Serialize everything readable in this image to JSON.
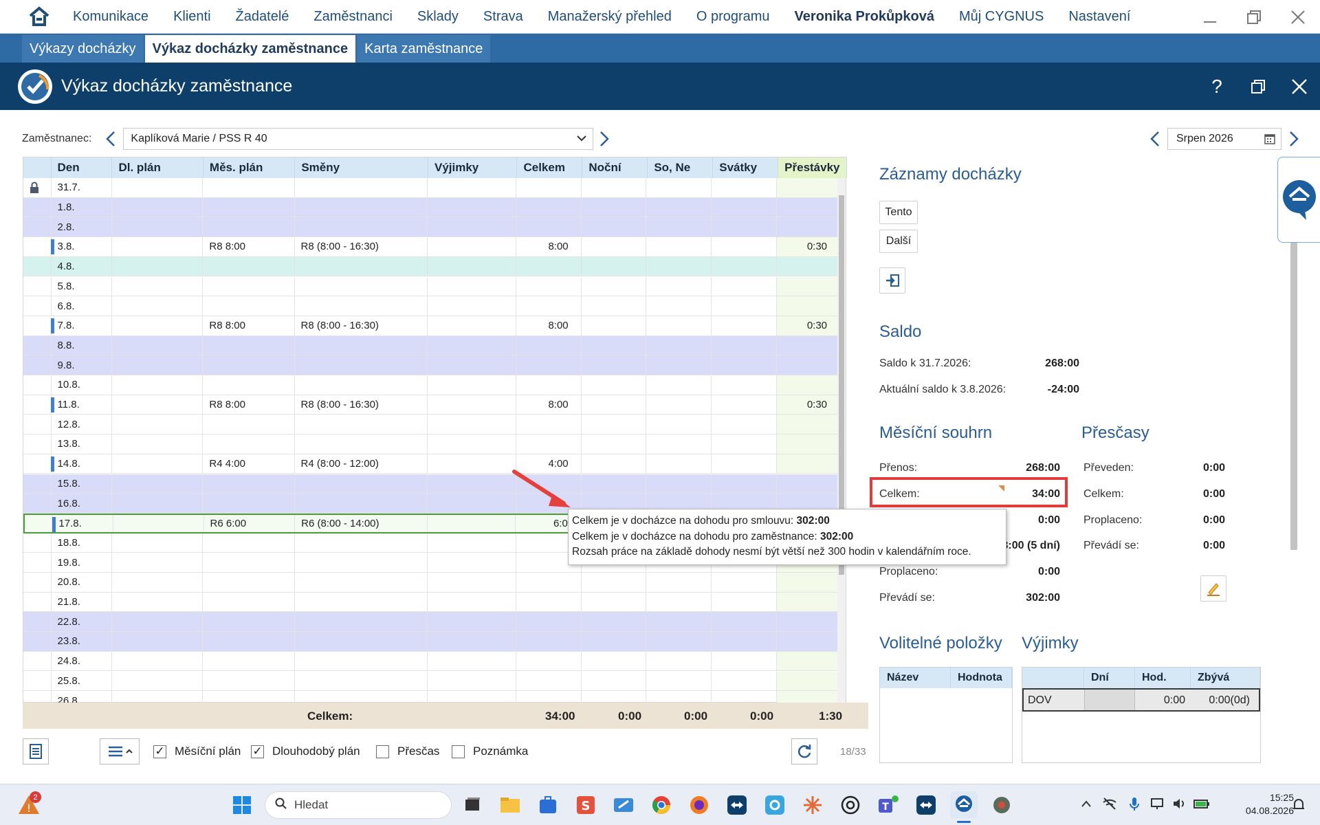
{
  "menu": {
    "items": [
      "Komunikace",
      "Klienti",
      "Žadatelé",
      "Zaměstnanci",
      "Sklady",
      "Strava",
      "Manažerský přehled",
      "O programu"
    ],
    "user": "Veronika Prokůpková",
    "extra": [
      "Můj CYGNUS",
      "Nastavení"
    ]
  },
  "tabs": [
    "Výkazy docházky",
    "Výkaz docházky zaměstnance",
    "Karta zaměstnance"
  ],
  "window": {
    "title": "Výkaz docházky zaměstnance",
    "help": "?"
  },
  "employee": {
    "label": "Zaměstnanec:",
    "value": "Kaplíková Marie / PSS R 40"
  },
  "month": {
    "value": "Srpen 2026"
  },
  "grid": {
    "columns": [
      "Den",
      "Dl. plán",
      "Měs. plán",
      "Směny",
      "Výjimky",
      "Celkem",
      "Noční",
      "So, Ne",
      "Svátky",
      "Přestávky"
    ],
    "rows": [
      {
        "den": "31.7.",
        "dl": "",
        "mes": "",
        "smeny": "",
        "vyjimky": "",
        "celkem": "",
        "nocni": "",
        "sone": "",
        "svatky": "",
        "prestavky": "",
        "type": "locked"
      },
      {
        "den": "1.8.",
        "dl": "",
        "mes": "",
        "smeny": "",
        "vyjimky": "",
        "celkem": "",
        "nocni": "",
        "sone": "",
        "svatky": "",
        "prestavky": "",
        "type": "we"
      },
      {
        "den": "2.8.",
        "dl": "",
        "mes": "",
        "smeny": "",
        "vyjimky": "",
        "celkem": "",
        "nocni": "",
        "sone": "",
        "svatky": "",
        "prestavky": "",
        "type": "we"
      },
      {
        "den": "3.8.",
        "dl": "",
        "mes": "R8 8:00",
        "smeny": "R8 (8:00 - 16:30)",
        "vyjimky": "",
        "celkem": "8:00",
        "nocni": "",
        "sone": "",
        "svatky": "",
        "prestavky": "0:30",
        "type": "work"
      },
      {
        "den": "4.8.",
        "dl": "",
        "mes": "",
        "smeny": "",
        "vyjimky": "",
        "celkem": "",
        "nocni": "",
        "sone": "",
        "svatky": "",
        "prestavky": "",
        "type": "hol"
      },
      {
        "den": "5.8.",
        "dl": "",
        "mes": "",
        "smeny": "",
        "vyjimky": "",
        "celkem": "",
        "nocni": "",
        "sone": "",
        "svatky": "",
        "prestavky": "",
        "type": ""
      },
      {
        "den": "6.8.",
        "dl": "",
        "mes": "",
        "smeny": "",
        "vyjimky": "",
        "celkem": "",
        "nocni": "",
        "sone": "",
        "svatky": "",
        "prestavky": "",
        "type": ""
      },
      {
        "den": "7.8.",
        "dl": "",
        "mes": "R8 8:00",
        "smeny": "R8 (8:00 - 16:30)",
        "vyjimky": "",
        "celkem": "8:00",
        "nocni": "",
        "sone": "",
        "svatky": "",
        "prestavky": "0:30",
        "type": "work"
      },
      {
        "den": "8.8.",
        "dl": "",
        "mes": "",
        "smeny": "",
        "vyjimky": "",
        "celkem": "",
        "nocni": "",
        "sone": "",
        "svatky": "",
        "prestavky": "",
        "type": "we"
      },
      {
        "den": "9.8.",
        "dl": "",
        "mes": "",
        "smeny": "",
        "vyjimky": "",
        "celkem": "",
        "nocni": "",
        "sone": "",
        "svatky": "",
        "prestavky": "",
        "type": "we"
      },
      {
        "den": "10.8.",
        "dl": "",
        "mes": "",
        "smeny": "",
        "vyjimky": "",
        "celkem": "",
        "nocni": "",
        "sone": "",
        "svatky": "",
        "prestavky": "",
        "type": ""
      },
      {
        "den": "11.8.",
        "dl": "",
        "mes": "R8 8:00",
        "smeny": "R8 (8:00 - 16:30)",
        "vyjimky": "",
        "celkem": "8:00",
        "nocni": "",
        "sone": "",
        "svatky": "",
        "prestavky": "0:30",
        "type": "work"
      },
      {
        "den": "12.8.",
        "dl": "",
        "mes": "",
        "smeny": "",
        "vyjimky": "",
        "celkem": "",
        "nocni": "",
        "sone": "",
        "svatky": "",
        "prestavky": "",
        "type": ""
      },
      {
        "den": "13.8.",
        "dl": "",
        "mes": "",
        "smeny": "",
        "vyjimky": "",
        "celkem": "",
        "nocni": "",
        "sone": "",
        "svatky": "",
        "prestavky": "",
        "type": ""
      },
      {
        "den": "14.8.",
        "dl": "",
        "mes": "R4 4:00",
        "smeny": "R4 (8:00 - 12:00)",
        "vyjimky": "",
        "celkem": "4:00",
        "nocni": "",
        "sone": "",
        "svatky": "",
        "prestavky": "",
        "type": "work"
      },
      {
        "den": "15.8.",
        "dl": "",
        "mes": "",
        "smeny": "",
        "vyjimky": "",
        "celkem": "",
        "nocni": "",
        "sone": "",
        "svatky": "",
        "prestavky": "",
        "type": "we"
      },
      {
        "den": "16.8.",
        "dl": "",
        "mes": "",
        "smeny": "",
        "vyjimky": "",
        "celkem": "",
        "nocni": "",
        "sone": "",
        "svatky": "",
        "prestavky": "",
        "type": "we"
      },
      {
        "den": "17.8.",
        "dl": "",
        "mes": "R6 6:00",
        "smeny": "R6 (8:00 - 14:00)",
        "vyjimky": "",
        "celkem": "6:0",
        "nocni": "",
        "sone": "",
        "svatky": "",
        "prestavky": "",
        "type": "sel"
      },
      {
        "den": "18.8.",
        "dl": "",
        "mes": "",
        "smeny": "",
        "vyjimky": "",
        "celkem": "",
        "nocni": "",
        "sone": "",
        "svatky": "",
        "prestavky": "",
        "type": ""
      },
      {
        "den": "19.8.",
        "dl": "",
        "mes": "",
        "smeny": "",
        "vyjimky": "",
        "celkem": "",
        "nocni": "",
        "sone": "",
        "svatky": "",
        "prestavky": "",
        "type": ""
      },
      {
        "den": "20.8.",
        "dl": "",
        "mes": "",
        "smeny": "",
        "vyjimky": "",
        "celkem": "",
        "nocni": "",
        "sone": "",
        "svatky": "",
        "prestavky": "",
        "type": ""
      },
      {
        "den": "21.8.",
        "dl": "",
        "mes": "",
        "smeny": "",
        "vyjimky": "",
        "celkem": "",
        "nocni": "",
        "sone": "",
        "svatky": "",
        "prestavky": "",
        "type": ""
      },
      {
        "den": "22.8.",
        "dl": "",
        "mes": "",
        "smeny": "",
        "vyjimky": "",
        "celkem": "",
        "nocni": "",
        "sone": "",
        "svatky": "",
        "prestavky": "",
        "type": "we"
      },
      {
        "den": "23.8.",
        "dl": "",
        "mes": "",
        "smeny": "",
        "vyjimky": "",
        "celkem": "",
        "nocni": "",
        "sone": "",
        "svatky": "",
        "prestavky": "",
        "type": "we"
      },
      {
        "den": "24.8.",
        "dl": "",
        "mes": "",
        "smeny": "",
        "vyjimky": "",
        "celkem": "",
        "nocni": "",
        "sone": "",
        "svatky": "",
        "prestavky": "",
        "type": ""
      },
      {
        "den": "25.8.",
        "dl": "",
        "mes": "",
        "smeny": "",
        "vyjimky": "",
        "celkem": "",
        "nocni": "",
        "sone": "",
        "svatky": "",
        "prestavky": "",
        "type": ""
      },
      {
        "den": "26.8.",
        "dl": "",
        "mes": "",
        "smeny": "",
        "vyjimky": "",
        "celkem": "",
        "nocni": "",
        "sone": "",
        "svatky": "",
        "prestavky": "",
        "type": ""
      }
    ],
    "totals": {
      "label": "Celkem:",
      "celkem": "34:00",
      "nocni": "0:00",
      "sone": "0:00",
      "svatky": "0:00",
      "prestavky": "1:30"
    }
  },
  "bottom": {
    "checkboxes": [
      {
        "label": "Měsíční plán",
        "checked": true
      },
      {
        "label": "Dlouhodobý plán",
        "checked": true
      },
      {
        "label": "Přesčas",
        "checked": false
      },
      {
        "label": "Poznámka",
        "checked": false
      }
    ],
    "counter": "18/33"
  },
  "right": {
    "zaznamy_title": "Záznamy docházky",
    "btn_tento": "Tento",
    "btn_dalsi": "Další",
    "saldo_title": "Saldo",
    "saldo": [
      {
        "label": "Saldo k 31.7.2026:",
        "value": "268:00"
      },
      {
        "label": "Aktuální saldo k 3.8.2026:",
        "value": "-24:00"
      }
    ],
    "mesicni_title": "Měsíční souhrn",
    "mesicni": [
      {
        "label": "Přenos:",
        "value": "268:00"
      },
      {
        "label": "Celkem:",
        "value": "34:00"
      },
      {
        "label": "",
        "value": "0:00"
      },
      {
        "label": "",
        "value": "3:00 (5 dní)"
      },
      {
        "label": "Proplaceno:",
        "value": "0:00"
      },
      {
        "label": "Převádí se:",
        "value": "302:00"
      }
    ],
    "prescasy_title": "Přesčasy",
    "prescasy": [
      {
        "label": "Převeden:",
        "value": "0:00"
      },
      {
        "label": "Celkem:",
        "value": "0:00"
      },
      {
        "label": "Proplaceno:",
        "value": "0:00"
      },
      {
        "label": "Převádí se:",
        "value": "0:00"
      }
    ],
    "volitelne_title": "Volitelné položky",
    "volitelne_cols": [
      "Název",
      "Hodnota"
    ],
    "vyjimky_title": "Výjimky",
    "vyjimky_cols": [
      "",
      "Dní",
      "Hod.",
      "Zbývá"
    ],
    "vyjimky_row": [
      "DOV",
      "",
      "0:00",
      "0:00(0d)"
    ]
  },
  "tooltip": {
    "line1_text": "Celkem je v docházce na dohodu pro smlouvu: ",
    "line1_value": "302:00",
    "line2_text": "Celkem je v docházce na dohodu pro zaměstnance: ",
    "line2_value": "302:00",
    "line3_text": "Rozsah práce na základě dohody nesmí být větší než 300 hodin v kalendářním roce."
  },
  "taskbar": {
    "search_placeholder": "Hledat",
    "badge": "2",
    "time": "15:25",
    "date": "04.08.2026"
  },
  "colors": {
    "accent": "#2e6aa3",
    "header_dark": "#0e3f6a",
    "weekend_row": "#d9dcf8",
    "holiday_row": "#d6f2ee",
    "highlight_box": "#e23b3b",
    "arrow": "#e6403d"
  }
}
